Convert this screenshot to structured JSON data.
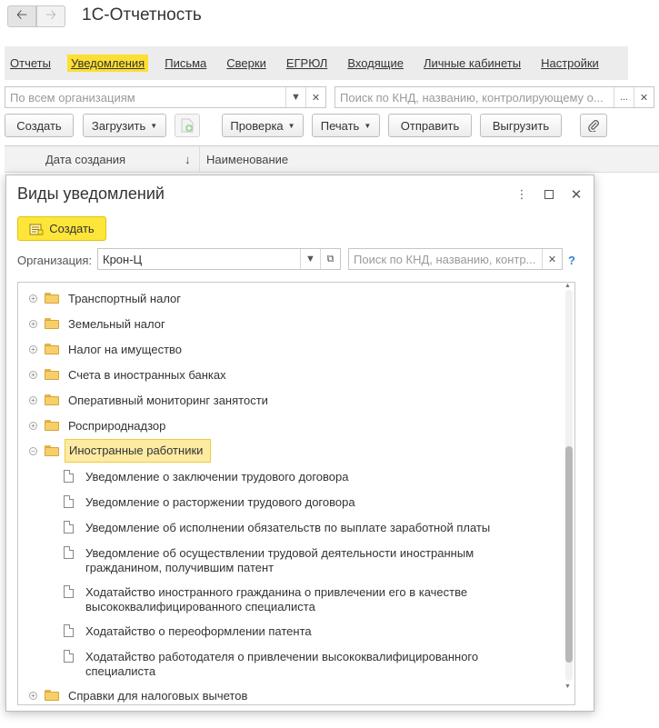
{
  "window": {
    "title": "1С-Отчетность",
    "back_icon": "arrow-left-icon",
    "forward_icon": "arrow-right-icon"
  },
  "menu": {
    "items": [
      "Отчеты",
      "Уведомления",
      "Письма",
      "Сверки",
      "ЕГРЮЛ",
      "Входящие",
      "Личные кабинеты",
      "Настройки"
    ],
    "active": "Уведомления"
  },
  "filters": {
    "organization_placeholder": "По всем организациям",
    "search_placeholder": "Поиск по КНД, названию, контролирующему о..."
  },
  "toolbar": {
    "create": "Создать",
    "load": "Загрузить",
    "check": "Проверка",
    "print": "Печать",
    "send": "Отправить",
    "export": "Выгрузить"
  },
  "table": {
    "col_date": "Дата создания",
    "col_name": "Наименование",
    "sort_indicator": "↓"
  },
  "dialog": {
    "title": "Виды уведомлений",
    "create": "Создать",
    "org_label": "Организация:",
    "org_value": "Крон-Ц",
    "search_placeholder": "Поиск по КНД, названию, контр...",
    "help": "?",
    "tree": [
      {
        "type": "folder",
        "label": "Транспортный налог",
        "expanded": false
      },
      {
        "type": "folder",
        "label": "Земельный налог",
        "expanded": false
      },
      {
        "type": "folder",
        "label": "Налог на имущество",
        "expanded": false
      },
      {
        "type": "folder",
        "label": "Счета в иностранных банках",
        "expanded": false
      },
      {
        "type": "folder",
        "label": "Оперативный мониторинг занятости",
        "expanded": false
      },
      {
        "type": "folder",
        "label": "Росприроднадзор",
        "expanded": false
      },
      {
        "type": "folder",
        "label": "Иностранные работники",
        "expanded": true,
        "selected": true
      },
      {
        "type": "doc",
        "lines": [
          "Уведомление о заключении трудового договора"
        ]
      },
      {
        "type": "doc",
        "lines": [
          "Уведомление о расторжении трудового договора"
        ]
      },
      {
        "type": "doc",
        "lines": [
          "Уведомление об исполнении обязательств по выплате заработной платы"
        ]
      },
      {
        "type": "doc",
        "lines": [
          "Уведомление об осуществлении трудовой деятельности иностранным",
          "гражданином, получившим патент"
        ]
      },
      {
        "type": "doc",
        "lines": [
          "Ходатайство иностранного гражданина о привлечении его в качестве",
          "высококвалифицированного специалиста"
        ]
      },
      {
        "type": "doc",
        "lines": [
          "Ходатайство о переоформлении патента"
        ]
      },
      {
        "type": "doc",
        "lines": [
          "Ходатайство работодателя о привлечении высококвалифицированного",
          "специалиста"
        ]
      },
      {
        "type": "folder",
        "label": "Справки для налоговых вычетов",
        "expanded": false
      }
    ]
  },
  "colors": {
    "accent_yellow": "#fde53a",
    "selection": "#fdeba2",
    "folder": "#f7cf6a",
    "link_blue": "#3a7fd0"
  }
}
